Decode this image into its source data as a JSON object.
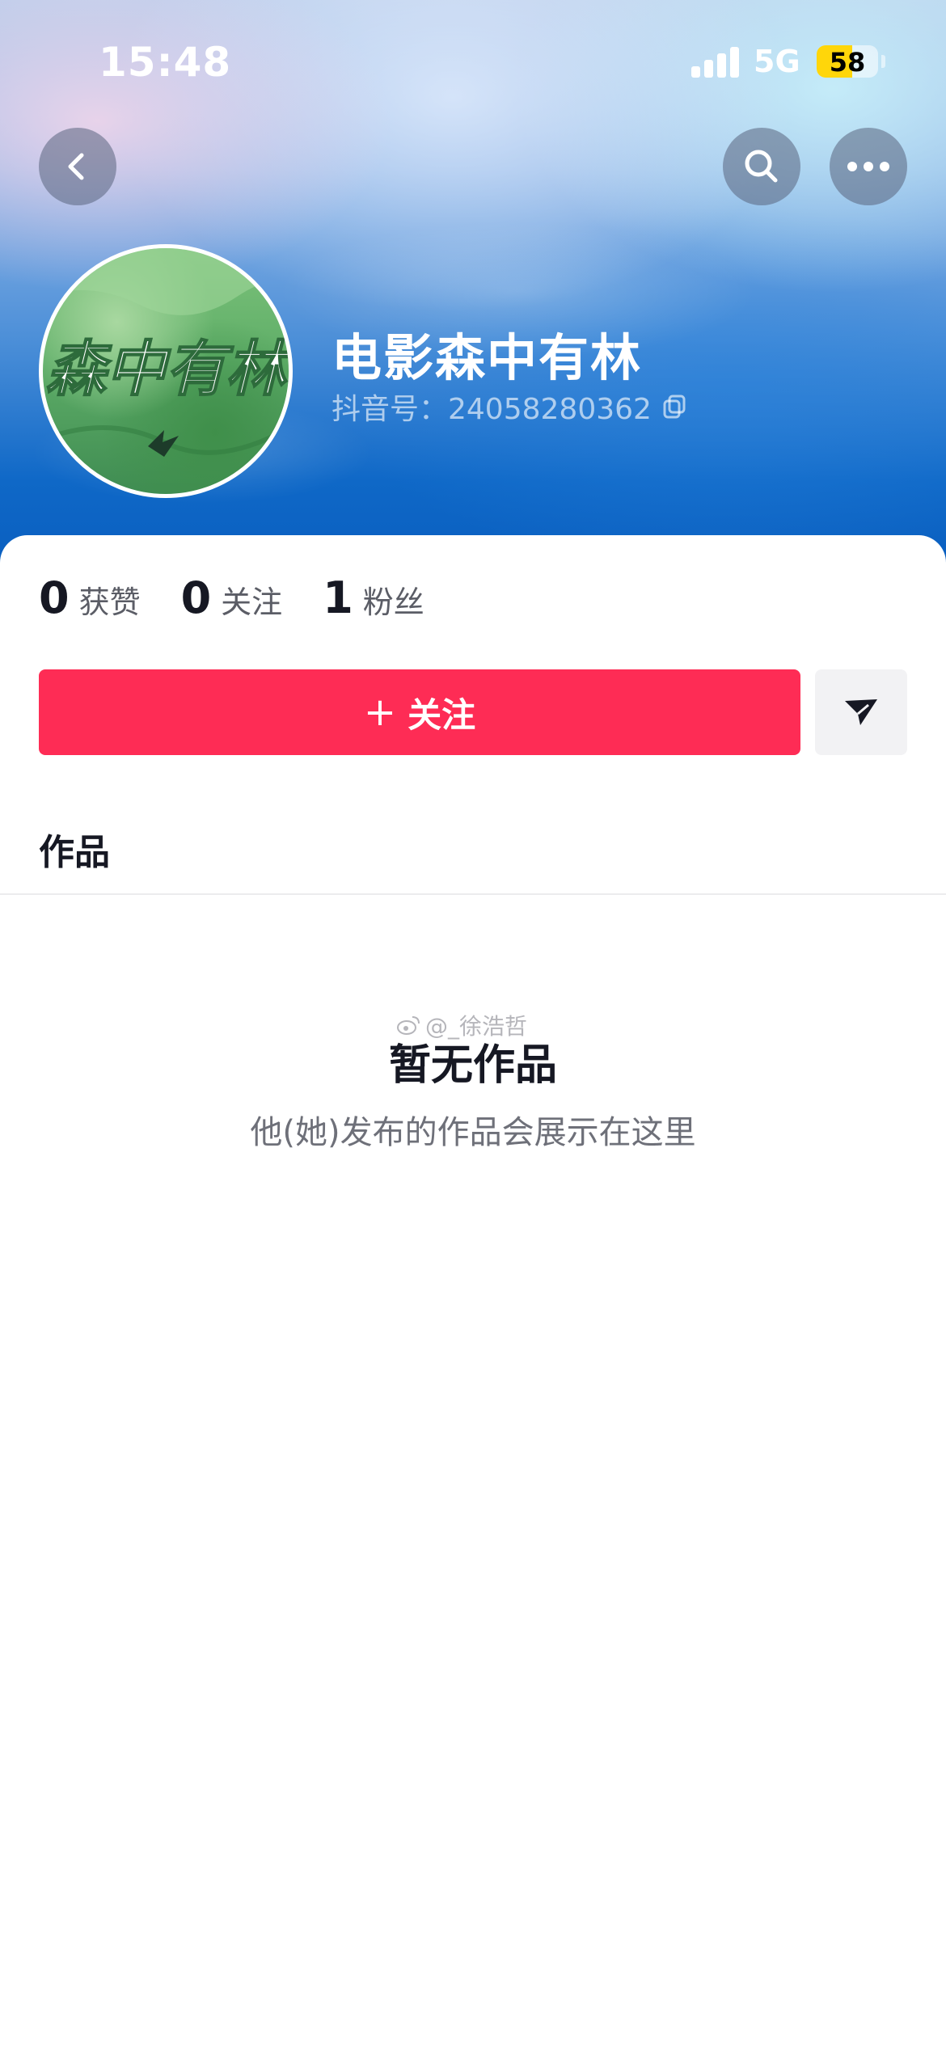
{
  "status_bar": {
    "time": "15:48",
    "network": "5G",
    "battery": "58",
    "battery_level": 0.58
  },
  "nav": {
    "back_icon": "chevron-left-icon",
    "search_icon": "search-icon",
    "more_icon": "more-dots-icon"
  },
  "profile": {
    "avatar_text": "森中有林",
    "name": "电影森中有林",
    "douyin_id": "抖音号：24058280362"
  },
  "stats": [
    {
      "num": "0",
      "label": "获赞"
    },
    {
      "num": "0",
      "label": "关注"
    },
    {
      "num": "1",
      "label": "粉丝"
    }
  ],
  "actions": {
    "follow_plus": "+",
    "follow_label": "关注",
    "message_icon": "send-icon"
  },
  "colors": {
    "follow": "#fe2c55",
    "battery": "#ffd60a"
  },
  "tabs": {
    "works": "作品"
  },
  "empty_state": {
    "title": "暂无作品",
    "description": "他(她)发布的作品会展示在这里"
  },
  "watermark": "@_徐浩哲"
}
